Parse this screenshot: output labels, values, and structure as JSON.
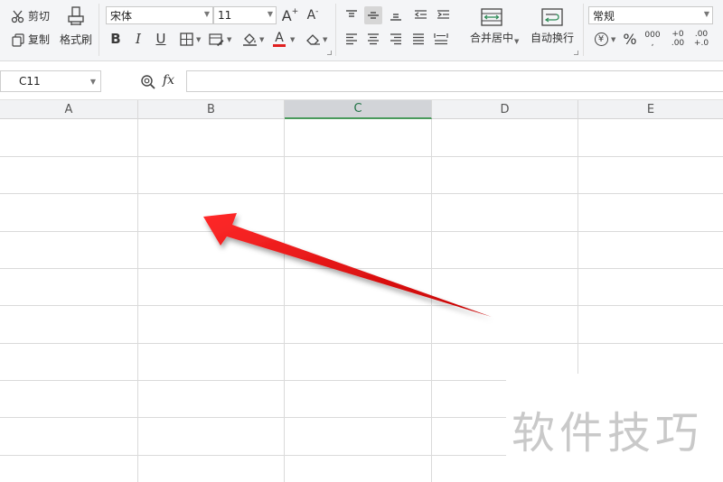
{
  "ribbon": {
    "clipboard": {
      "cut": "剪切",
      "copy": "复制",
      "format_painter": "格式刷"
    },
    "font": {
      "name": "宋体",
      "size": "11",
      "increase": "A",
      "decrease": "A",
      "bold": "B",
      "italic": "I",
      "underline": "U",
      "font_color_letter": "A"
    },
    "alignment": {
      "merge_center": "合并居中",
      "wrap_text": "自动换行"
    },
    "number": {
      "format": "常规",
      "currency": "¥",
      "percent": "%",
      "thousands": "000",
      "inc_decimal": "+0 .00",
      "dec_decimal": ".00 +.0"
    },
    "colors": {
      "font_color_bar": "#e02020",
      "accent_green": "#217346"
    }
  },
  "formula_bar": {
    "cell_ref": "C11",
    "fx": "fx",
    "value": ""
  },
  "grid": {
    "columns": [
      "A",
      "B",
      "C",
      "D",
      "E"
    ],
    "selected_column": "C"
  },
  "watermark": "软件技巧"
}
